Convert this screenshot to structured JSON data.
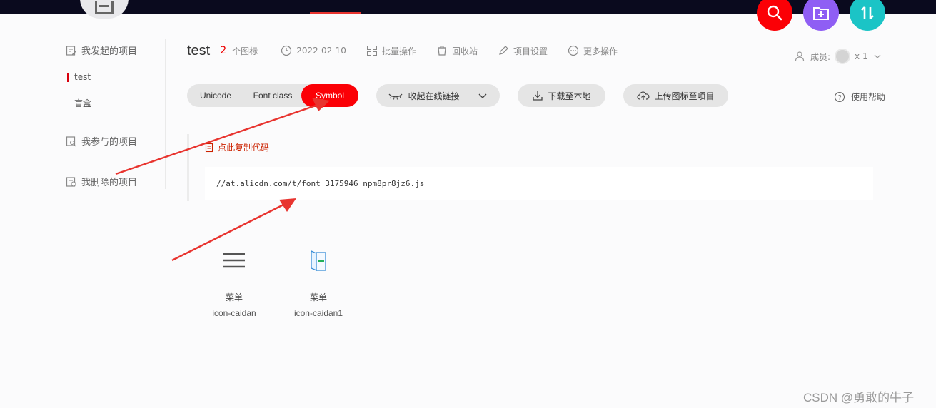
{
  "header": {
    "project_title": "test",
    "icon_count": "2",
    "icon_count_unit": "个图标",
    "date": "2022-02-10",
    "batch_ops": "批量操作",
    "recycle_bin": "回收站",
    "project_settings": "项目设置",
    "more_actions": "更多操作",
    "members_label": "成员:",
    "members_count": "x 1"
  },
  "sidebar": {
    "my_projects": "我发起的项目",
    "projects": [
      {
        "label": "test",
        "active": true
      },
      {
        "label": "盲盒",
        "active": false
      }
    ],
    "joined_projects": "我参与的项目",
    "deleted_projects": "我删除的项目"
  },
  "tabs": {
    "unicode": "Unicode",
    "font_class": "Font class",
    "symbol": "Symbol",
    "active": "Symbol"
  },
  "actions": {
    "collapse_link": "收起在线链接",
    "download": "下载至本地",
    "upload": "上传图标至项目",
    "help": "使用帮助"
  },
  "code": {
    "copy_label": "点此复制代码",
    "url": "//at.alicdn.com/t/font_3175946_npm8pr8jz6.js"
  },
  "icons": [
    {
      "name": "菜单",
      "code": "icon-caidan",
      "icon": "menu-icon"
    },
    {
      "name": "菜单",
      "code": "icon-caidan1",
      "icon": "menu-book-icon"
    }
  ],
  "watermark": "CSDN @勇敢的牛子",
  "colors": {
    "accent_red": "#fb0006",
    "purple": "#8f5ef4",
    "teal": "#1bc4c6",
    "topbar": "#0a0a1e",
    "annotation_arrow": "#e8342f"
  }
}
